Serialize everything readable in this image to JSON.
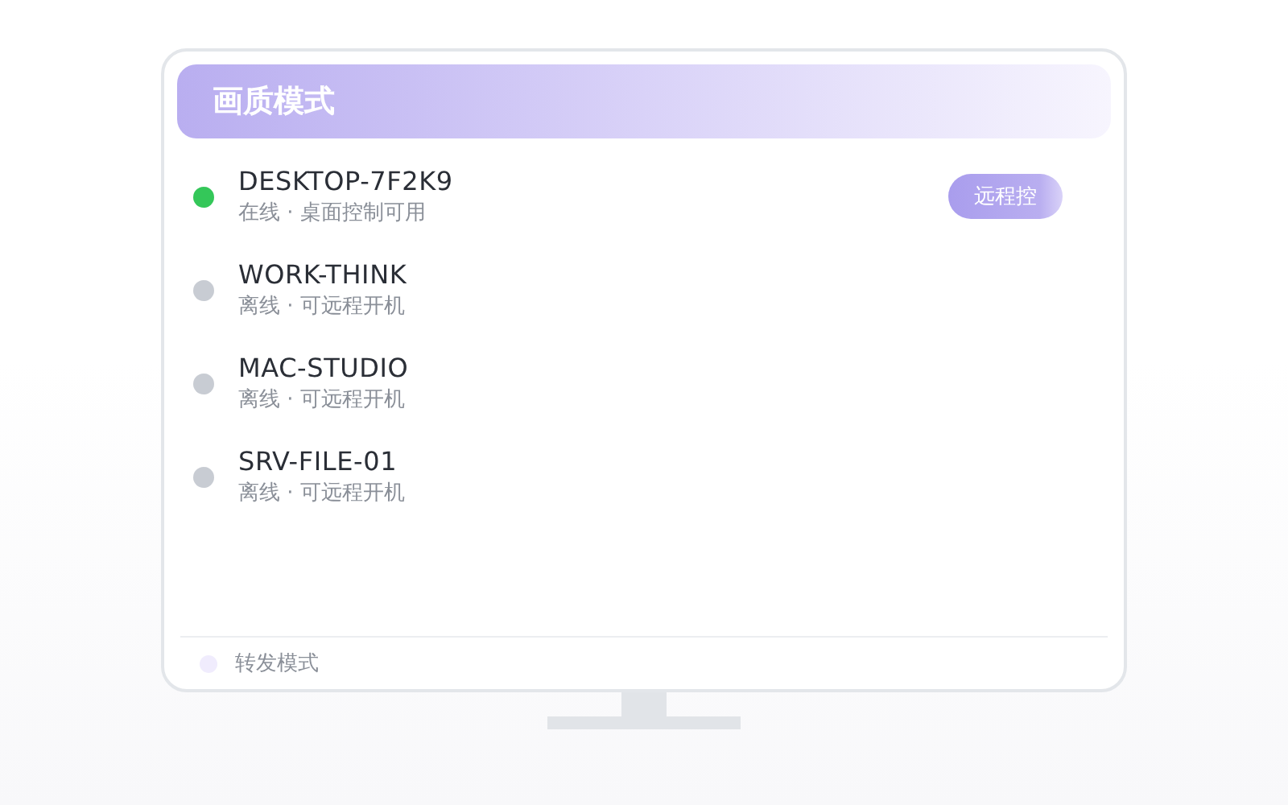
{
  "header": {
    "title": "画质模式"
  },
  "devices": [
    {
      "name": "DESKTOP-7F2K9",
      "status": "在线 · 桌面控制可用",
      "color": "#34c759",
      "action": "远程控"
    },
    {
      "name": "WORK-THINK",
      "status": "离线 · 可远程开机",
      "color": "#c8ccd3"
    },
    {
      "name": "MAC-STUDIO",
      "status": "离线 · 可远程开机",
      "color": "#c8ccd3"
    },
    {
      "name": "SRV-FILE-01",
      "status": "离线 · 可远程开机",
      "color": "#c8ccd3"
    }
  ],
  "footer": {
    "label": "转发模式"
  }
}
